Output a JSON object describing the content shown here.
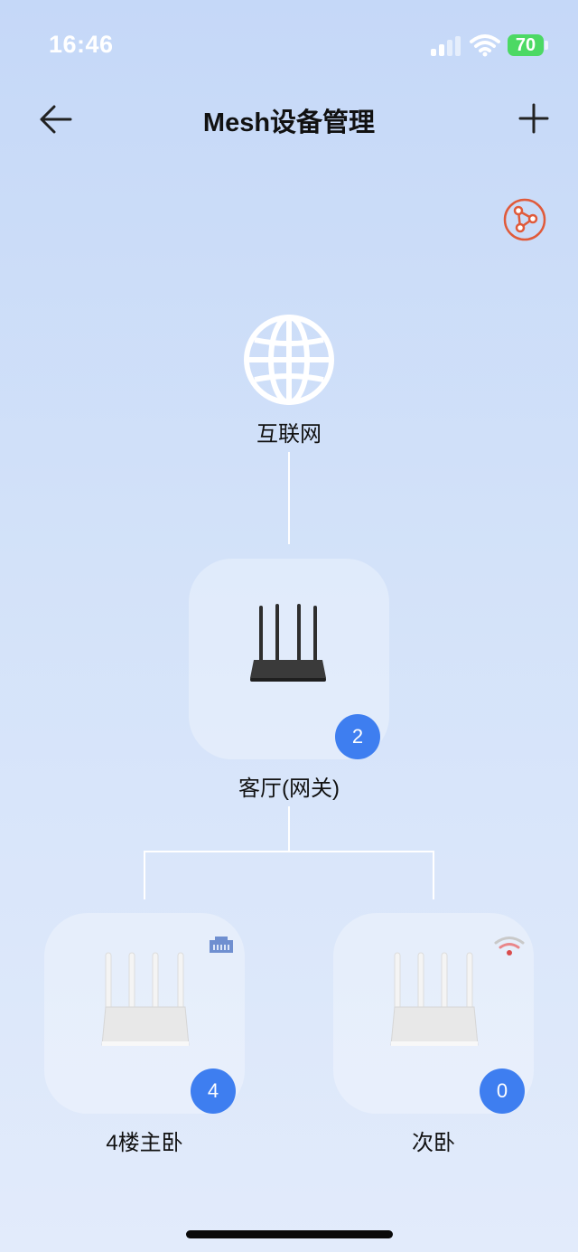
{
  "status_bar": {
    "time": "16:46",
    "battery": "70"
  },
  "header": {
    "title": "Mesh设备管理"
  },
  "internet": {
    "label": "互联网",
    "icon": "globe-icon"
  },
  "devices": {
    "main": {
      "name": "客厅(网关)",
      "count": "2",
      "color": "dark"
    },
    "left": {
      "name": "4楼主卧",
      "count": "4",
      "connection": "ethernet-icon"
    },
    "right": {
      "name": "次卧",
      "count": "0",
      "connection": "wifi-weak-icon"
    }
  },
  "colors": {
    "badge": "#3e7ef0",
    "topology_accent": "#e05a3a",
    "battery": "#4cd964"
  }
}
